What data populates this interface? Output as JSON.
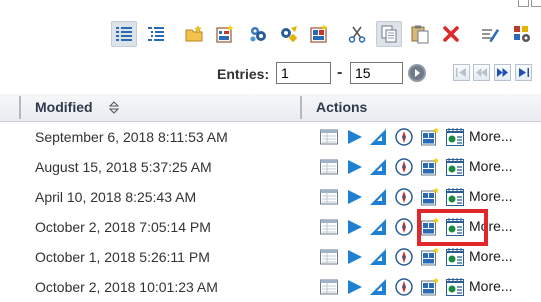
{
  "toolbar": {
    "buttons": [
      {
        "icon": "details-view-icon",
        "active": true
      },
      {
        "icon": "tree-view-icon"
      },
      {
        "icon": "new-folder-icon"
      },
      {
        "icon": "new-report-icon"
      },
      {
        "icon": "schedule-icon"
      },
      {
        "icon": "schedule-settings-icon"
      },
      {
        "icon": "new-dashboard-icon"
      },
      {
        "icon": "cut-icon"
      },
      {
        "icon": "copy-icon",
        "active": true
      },
      {
        "icon": "paste-icon"
      },
      {
        "icon": "delete-icon"
      },
      {
        "icon": "edit-properties-icon"
      },
      {
        "icon": "set-properties-icon"
      }
    ]
  },
  "pagination": {
    "label": "Entries:",
    "from": "1",
    "dash": "-",
    "to": "15"
  },
  "table": {
    "columns": {
      "modified": "Modified",
      "actions": "Actions"
    },
    "rows": [
      {
        "modified": "September 6, 2018 8:11:53 AM",
        "more": "More..."
      },
      {
        "modified": "August 15, 2018 5:37:25 AM",
        "more": "More..."
      },
      {
        "modified": "April 10, 2018 8:25:43 AM",
        "more": "More..."
      },
      {
        "modified": "October 2, 2018 7:05:14 PM",
        "more": "More..."
      },
      {
        "modified": "October 1, 2018 5:26:11 PM",
        "more": "More..."
      },
      {
        "modified": "October 2, 2018 10:01:23 AM",
        "more": "More..."
      }
    ]
  },
  "colors": {
    "highlight": "#e0272a",
    "action_blue": "#1f7fd1",
    "header_text": "#2f3b4a"
  }
}
